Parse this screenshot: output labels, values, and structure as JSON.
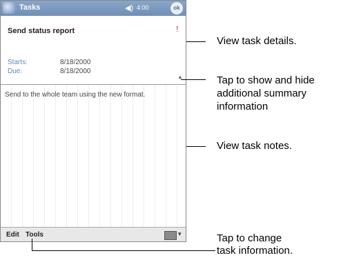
{
  "titlebar": {
    "app_title": "Tasks",
    "time": "4:00"
  },
  "task": {
    "title": "Send status report",
    "start_label": "Starts:",
    "start_value": "8/18/2000",
    "due_label": "Due:",
    "due_value": "8/18/2000",
    "notes": "Send to the whole team using the new format."
  },
  "menubar": {
    "edit": "Edit",
    "tools": "Tools"
  },
  "callouts": {
    "view_details": "View task details.",
    "tap_summary_1": "Tap to show and hide",
    "tap_summary_2": "additional summary",
    "tap_summary_3": "information",
    "view_notes": "View task notes.",
    "tap_change_1": "Tap to change",
    "tap_change_2": "task information."
  }
}
